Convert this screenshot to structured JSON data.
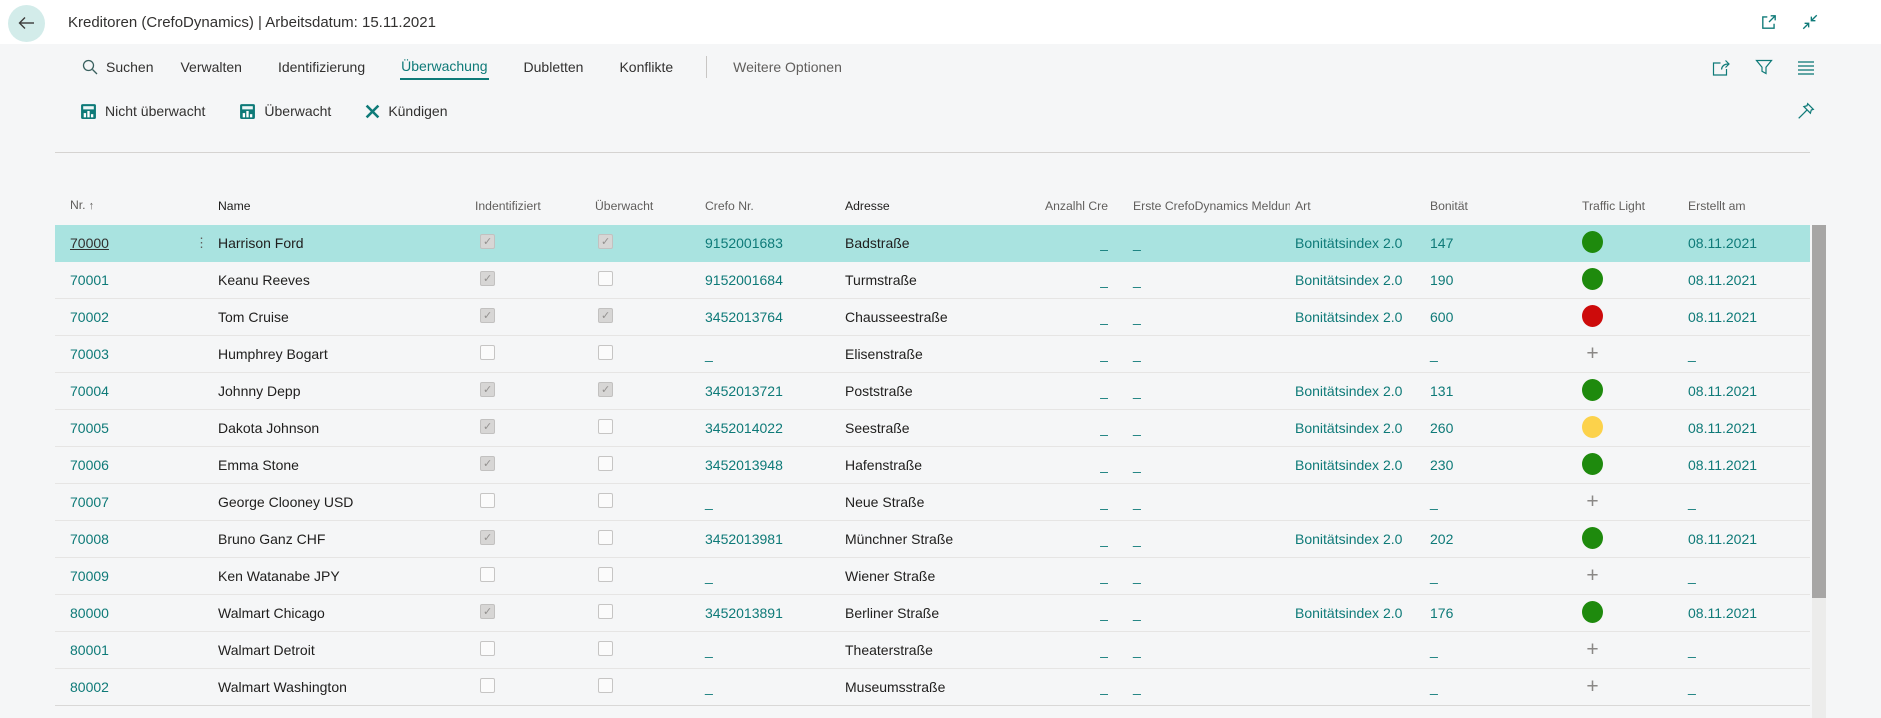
{
  "colors": {
    "accent": "#0e7a78",
    "selected_row": "#a9e3e0",
    "traffic": {
      "green": "#1e8a0d",
      "yellow": "#fcd24b",
      "red": "#cd0b0b"
    }
  },
  "topbar": {
    "title": "Kreditoren (CrefoDynamics) | Arbeitsdatum: 15.11.2021"
  },
  "menubar": {
    "search_label": "Suchen",
    "items": [
      {
        "label": "Verwalten",
        "active": false
      },
      {
        "label": "Identifizierung",
        "active": false
      },
      {
        "label": "Überwachung",
        "active": true
      },
      {
        "label": "Dubletten",
        "active": false
      },
      {
        "label": "Konflikte",
        "active": false
      }
    ],
    "more_label": "Weitere Optionen"
  },
  "actionbar": {
    "items": [
      {
        "label": "Nicht überwacht",
        "icon": "report"
      },
      {
        "label": "Überwacht",
        "icon": "report"
      },
      {
        "label": "Kündigen",
        "icon": "dismiss"
      }
    ]
  },
  "table": {
    "columns": [
      {
        "key": "nr",
        "label": "Nr.",
        "sort": "↑"
      },
      {
        "key": "name",
        "label": "Name"
      },
      {
        "key": "ident",
        "label": "Indentifiziert"
      },
      {
        "key": "uberw",
        "label": "Überwacht"
      },
      {
        "key": "crefo",
        "label": "Crefo Nr."
      },
      {
        "key": "adresse",
        "label": "Adresse"
      },
      {
        "key": "anzahl",
        "label": "Anzalhl\nCrefoDynamics\nMeldungen"
      },
      {
        "key": "erste",
        "label": "Erste CrefoDynamics\nMeldung"
      },
      {
        "key": "art",
        "label": "Art"
      },
      {
        "key": "bonitaet",
        "label": "Bonität"
      },
      {
        "key": "traffic",
        "label": "Traffic Light"
      },
      {
        "key": "erstellt",
        "label": "Erstellt am"
      }
    ],
    "rows": [
      {
        "nr": "70000",
        "name": "Harrison Ford",
        "identifiziert": true,
        "ueberwacht": true,
        "crefo": "9152001683",
        "adresse": "Badstraße",
        "anzahl": "_",
        "erste": "_",
        "art": "Bonitätsindex 2.0",
        "bonitaet": "147",
        "traffic": "green",
        "erstellt": "08.11.2021",
        "selected": true
      },
      {
        "nr": "70001",
        "name": "Keanu Reeves",
        "identifiziert": true,
        "ueberwacht": false,
        "crefo": "9152001684",
        "adresse": "Turmstraße",
        "anzahl": "_",
        "erste": "_",
        "art": "Bonitätsindex 2.0",
        "bonitaet": "190",
        "traffic": "green",
        "erstellt": "08.11.2021",
        "selected": false
      },
      {
        "nr": "70002",
        "name": "Tom Cruise",
        "identifiziert": true,
        "ueberwacht": true,
        "crefo": "3452013764",
        "adresse": "Chausseestraße",
        "anzahl": "_",
        "erste": "_",
        "art": "Bonitätsindex 2.0",
        "bonitaet": "600",
        "traffic": "red",
        "erstellt": "08.11.2021",
        "selected": false
      },
      {
        "nr": "70003",
        "name": "Humphrey Bogart",
        "identifiziert": false,
        "ueberwacht": false,
        "crefo": "_",
        "adresse": "Elisenstraße",
        "anzahl": "_",
        "erste": "_",
        "art": "",
        "bonitaet": "_",
        "traffic": "plus",
        "erstellt": "_",
        "selected": false
      },
      {
        "nr": "70004",
        "name": "Johnny Depp",
        "identifiziert": true,
        "ueberwacht": true,
        "crefo": "3452013721",
        "adresse": "Poststraße",
        "anzahl": "_",
        "erste": "_",
        "art": "Bonitätsindex 2.0",
        "bonitaet": "131",
        "traffic": "green",
        "erstellt": "08.11.2021",
        "selected": false
      },
      {
        "nr": "70005",
        "name": "Dakota Johnson",
        "identifiziert": true,
        "ueberwacht": false,
        "crefo": "3452014022",
        "adresse": "Seestraße",
        "anzahl": "_",
        "erste": "_",
        "art": "Bonitätsindex 2.0",
        "bonitaet": "260",
        "traffic": "yellow",
        "erstellt": "08.11.2021",
        "selected": false
      },
      {
        "nr": "70006",
        "name": "Emma Stone",
        "identifiziert": true,
        "ueberwacht": false,
        "crefo": "3452013948",
        "adresse": "Hafenstraße",
        "anzahl": "_",
        "erste": "_",
        "art": "Bonitätsindex 2.0",
        "bonitaet": "230",
        "traffic": "green",
        "erstellt": "08.11.2021",
        "selected": false
      },
      {
        "nr": "70007",
        "name": "George Clooney USD",
        "identifiziert": false,
        "ueberwacht": false,
        "crefo": "_",
        "adresse": "Neue Straße",
        "anzahl": "_",
        "erste": "_",
        "art": "",
        "bonitaet": "_",
        "traffic": "plus",
        "erstellt": "_",
        "selected": false
      },
      {
        "nr": "70008",
        "name": "Bruno Ganz CHF",
        "identifiziert": true,
        "ueberwacht": false,
        "crefo": "3452013981",
        "adresse": "Münchner Straße",
        "anzahl": "_",
        "erste": "_",
        "art": "Bonitätsindex 2.0",
        "bonitaet": "202",
        "traffic": "green",
        "erstellt": "08.11.2021",
        "selected": false
      },
      {
        "nr": "70009",
        "name": "Ken Watanabe JPY",
        "identifiziert": false,
        "ueberwacht": false,
        "crefo": "_",
        "adresse": "Wiener Straße",
        "anzahl": "_",
        "erste": "_",
        "art": "",
        "bonitaet": "_",
        "traffic": "plus",
        "erstellt": "_",
        "selected": false
      },
      {
        "nr": "80000",
        "name": "Walmart Chicago",
        "identifiziert": true,
        "ueberwacht": false,
        "crefo": "3452013891",
        "adresse": "Berliner Straße",
        "anzahl": "_",
        "erste": "_",
        "art": "Bonitätsindex 2.0",
        "bonitaet": "176",
        "traffic": "green",
        "erstellt": "08.11.2021",
        "selected": false
      },
      {
        "nr": "80001",
        "name": "Walmart Detroit",
        "identifiziert": false,
        "ueberwacht": false,
        "crefo": "_",
        "adresse": "Theaterstraße",
        "anzahl": "_",
        "erste": "_",
        "art": "",
        "bonitaet": "_",
        "traffic": "plus",
        "erstellt": "_",
        "selected": false
      },
      {
        "nr": "80002",
        "name": "Walmart Washington",
        "identifiziert": false,
        "ueberwacht": false,
        "crefo": "_",
        "adresse": "Museumsstraße",
        "anzahl": "_",
        "erste": "_",
        "art": "",
        "bonitaet": "_",
        "traffic": "plus",
        "erstellt": "_",
        "selected": false
      }
    ]
  }
}
